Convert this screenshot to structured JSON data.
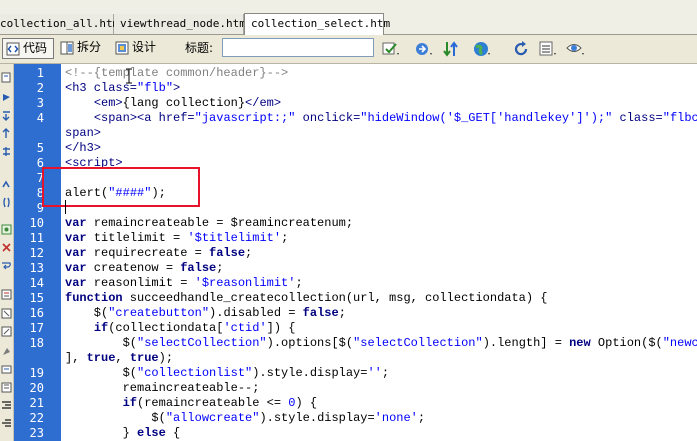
{
  "tabs": [
    {
      "label": "collection_all.htm",
      "active": false
    },
    {
      "label": "viewthread_node.htm",
      "active": false
    },
    {
      "label": "collection_select.htm",
      "active": true
    }
  ],
  "toolbar": {
    "code_label": "代码",
    "split_label": "拆分",
    "design_label": "设计",
    "title_label": "标题:",
    "title_value": ""
  },
  "line_numbers": [
    "1",
    "2",
    "3",
    "4",
    "",
    "5",
    "6",
    "7",
    "8",
    "9",
    "10",
    "11",
    "12",
    "13",
    "14",
    "15",
    "16",
    "17",
    "18",
    "",
    "19",
    "20",
    "21",
    "22",
    "23"
  ],
  "code": [
    {
      "segs": [
        {
          "c": "cm",
          "t": "<!--{template common/header}-->"
        }
      ]
    },
    {
      "segs": [
        {
          "c": "tag",
          "t": "<h3 class="
        },
        {
          "c": "str",
          "t": "\"flb\""
        },
        {
          "c": "tag",
          "t": ">"
        }
      ]
    },
    {
      "segs": [
        {
          "c": "pl",
          "t": "    "
        },
        {
          "c": "tag",
          "t": "<em>"
        },
        {
          "c": "pl",
          "t": "{lang collection}"
        },
        {
          "c": "tag",
          "t": "</em>"
        }
      ]
    },
    {
      "segs": [
        {
          "c": "pl",
          "t": "    "
        },
        {
          "c": "tag",
          "t": "<span><a href="
        },
        {
          "c": "str",
          "t": "\"javascript:;\""
        },
        {
          "c": "tag",
          "t": " onclick="
        },
        {
          "c": "str",
          "t": "\"hideWindow('$_GET['handlekey']');\""
        },
        {
          "c": "tag",
          "t": " class="
        },
        {
          "c": "str",
          "t": "\"flbc\""
        },
        {
          "c": "tag",
          "t": " t"
        }
      ]
    },
    {
      "segs": [
        {
          "c": "tag",
          "t": "span>"
        }
      ]
    },
    {
      "segs": [
        {
          "c": "tag",
          "t": "</h3>"
        }
      ]
    },
    {
      "segs": [
        {
          "c": "tag",
          "t": "<script>"
        }
      ]
    },
    {
      "segs": []
    },
    {
      "segs": [
        {
          "c": "pl",
          "t": "alert("
        },
        {
          "c": "str",
          "t": "\"####\""
        },
        {
          "c": "pl",
          "t": ");"
        }
      ]
    },
    {
      "segs": []
    },
    {
      "segs": [
        {
          "c": "kw",
          "t": "var"
        },
        {
          "c": "pl",
          "t": " remaincreateable = $reamincreatenum;"
        }
      ]
    },
    {
      "segs": [
        {
          "c": "kw",
          "t": "var"
        },
        {
          "c": "pl",
          "t": " titlelimit = "
        },
        {
          "c": "str",
          "t": "'$titlelimit'"
        },
        {
          "c": "pl",
          "t": ";"
        }
      ]
    },
    {
      "segs": [
        {
          "c": "kw",
          "t": "var"
        },
        {
          "c": "pl",
          "t": " requirecreate = "
        },
        {
          "c": "kw",
          "t": "false"
        },
        {
          "c": "pl",
          "t": ";"
        }
      ]
    },
    {
      "segs": [
        {
          "c": "kw",
          "t": "var"
        },
        {
          "c": "pl",
          "t": " createnow = "
        },
        {
          "c": "kw",
          "t": "false"
        },
        {
          "c": "pl",
          "t": ";"
        }
      ]
    },
    {
      "segs": [
        {
          "c": "kw",
          "t": "var"
        },
        {
          "c": "pl",
          "t": " reasonlimit = "
        },
        {
          "c": "str",
          "t": "'$reasonlimit'"
        },
        {
          "c": "pl",
          "t": ";"
        }
      ]
    },
    {
      "segs": [
        {
          "c": "kw",
          "t": "function"
        },
        {
          "c": "pl",
          "t": " succeedhandle_createcollection(url, msg, collectiondata) {"
        }
      ]
    },
    {
      "segs": [
        {
          "c": "pl",
          "t": "    $("
        },
        {
          "c": "str",
          "t": "\"createbutton\""
        },
        {
          "c": "pl",
          "t": ").disabled = "
        },
        {
          "c": "kw",
          "t": "false"
        },
        {
          "c": "pl",
          "t": ";"
        }
      ]
    },
    {
      "segs": [
        {
          "c": "pl",
          "t": "    "
        },
        {
          "c": "kw",
          "t": "if"
        },
        {
          "c": "pl",
          "t": "(collectiondata["
        },
        {
          "c": "str",
          "t": "'ctid'"
        },
        {
          "c": "pl",
          "t": "]) {"
        }
      ]
    },
    {
      "segs": [
        {
          "c": "pl",
          "t": "        $("
        },
        {
          "c": "str",
          "t": "\"selectCollection\""
        },
        {
          "c": "pl",
          "t": ").options[$("
        },
        {
          "c": "str",
          "t": "\"selectCollection\""
        },
        {
          "c": "pl",
          "t": ").length] = "
        },
        {
          "c": "kw",
          "t": "new"
        },
        {
          "c": "pl",
          "t": " Option($("
        },
        {
          "c": "str",
          "t": "\"newco"
        }
      ]
    },
    {
      "segs": [
        {
          "c": "pl",
          "t": "], "
        },
        {
          "c": "kw",
          "t": "true"
        },
        {
          "c": "pl",
          "t": ", "
        },
        {
          "c": "kw",
          "t": "true"
        },
        {
          "c": "pl",
          "t": ");"
        }
      ]
    },
    {
      "segs": [
        {
          "c": "pl",
          "t": "        $("
        },
        {
          "c": "str",
          "t": "\"collectionlist\""
        },
        {
          "c": "pl",
          "t": ").style.display="
        },
        {
          "c": "str",
          "t": "''"
        },
        {
          "c": "pl",
          "t": ";"
        }
      ]
    },
    {
      "segs": [
        {
          "c": "pl",
          "t": "        remaincreateable--;"
        }
      ]
    },
    {
      "segs": [
        {
          "c": "pl",
          "t": "        "
        },
        {
          "c": "kw",
          "t": "if"
        },
        {
          "c": "pl",
          "t": "(remaincreateable <= "
        },
        {
          "c": "str",
          "t": "0"
        },
        {
          "c": "pl",
          "t": ") {"
        }
      ]
    },
    {
      "segs": [
        {
          "c": "pl",
          "t": "            $("
        },
        {
          "c": "str",
          "t": "\"allowcreate\""
        },
        {
          "c": "pl",
          "t": ").style.display="
        },
        {
          "c": "str",
          "t": "'none'"
        },
        {
          "c": "pl",
          "t": ";"
        }
      ]
    },
    {
      "segs": [
        {
          "c": "pl",
          "t": "        } "
        },
        {
          "c": "kw",
          "t": "else"
        },
        {
          "c": "pl",
          "t": " {"
        }
      ]
    }
  ]
}
